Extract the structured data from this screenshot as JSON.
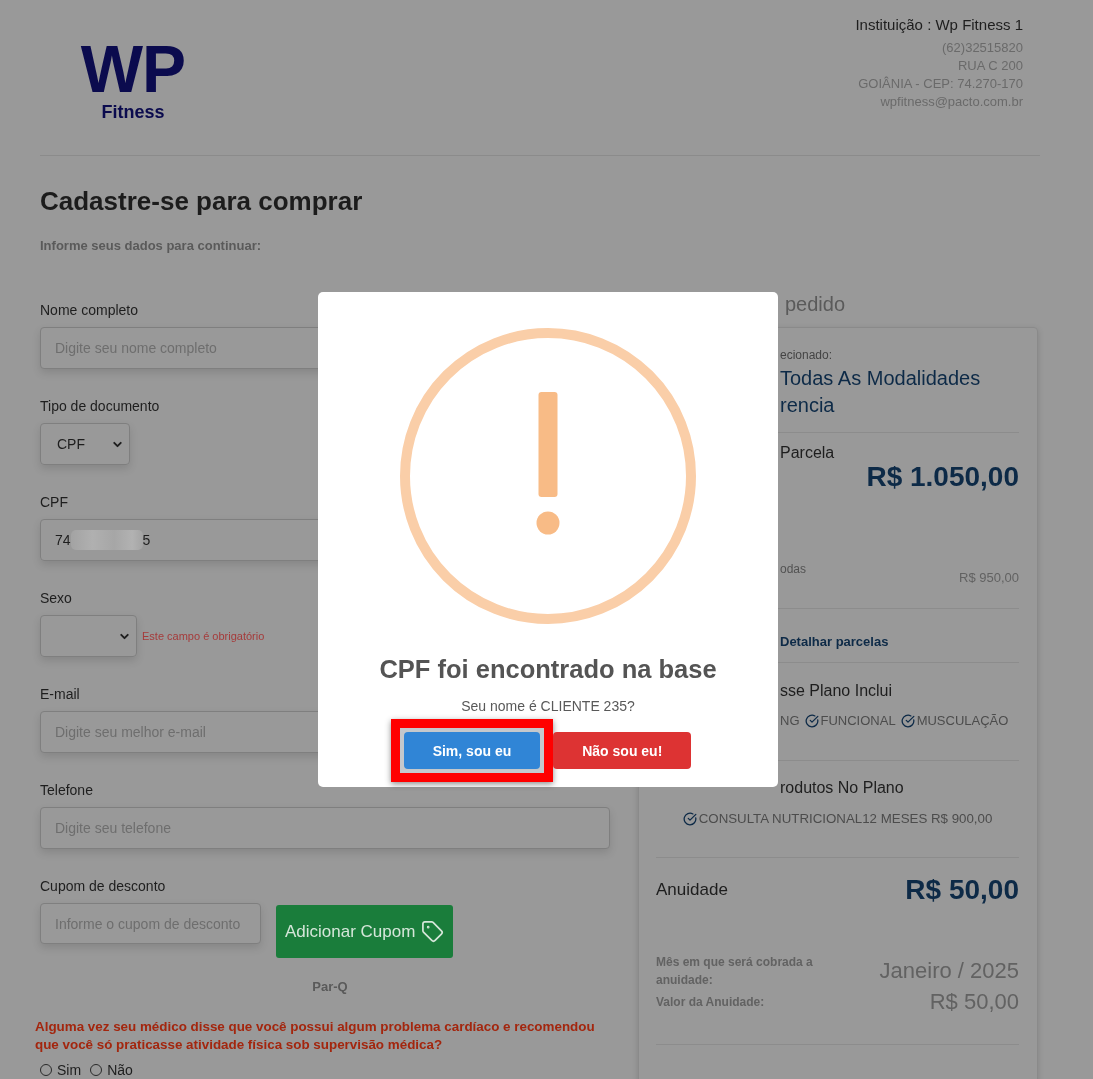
{
  "header": {
    "logo": {
      "mark": "WP",
      "subtitle": "Fitness"
    },
    "institution": "Instituição : Wp Fitness 1",
    "contact_lines": [
      "(62)32515820",
      "RUA C 200",
      "GOIÂNIA - CEP: 74.270-170",
      "wpfitness@pacto.com.br"
    ]
  },
  "form": {
    "title": "Cadastre-se para comprar",
    "subtitle": "Informe seus dados para continuar:",
    "fields": [
      {
        "kind": "input",
        "label": "Nome completo",
        "placeholder": "Digite seu nome completo"
      },
      {
        "kind": "select",
        "label": "Tipo de documento",
        "value": "CPF"
      },
      {
        "kind": "redacted_input",
        "label": "CPF",
        "value_start": "74",
        "value_end": "5"
      },
      {
        "kind": "select",
        "label": "Sexo",
        "error": "Este campo é obrigatório"
      },
      {
        "kind": "input",
        "label": "E-mail",
        "placeholder": "Digite seu melhor e-mail"
      },
      {
        "kind": "input",
        "label": "Telefone",
        "placeholder": "Digite seu telefone"
      },
      {
        "kind": "coupon",
        "label": "Cupom de desconto",
        "placeholder": "Informe o cupom de desconto",
        "button": "Adicionar Cupom"
      }
    ],
    "parq": {
      "title": "Par-Q",
      "question": "Alguma vez seu médico disse que você possui algum problema cardíaco e recomendou que você só praticasse atividade física sob supervisão médica?",
      "options": [
        {
          "label": "Sim",
          "selected": false
        },
        {
          "label": "Não",
          "selected": false
        }
      ]
    }
  },
  "order_summary": {
    "heading": "pedido",
    "plan_label": "ecionado:",
    "plan_name": [
      "Todas As Modalidades",
      "rencia"
    ],
    "installment": {
      "label": "Parcela",
      "price": "R$ 1.050,00"
    },
    "discount": {
      "label": "odas",
      "value": "R$ 950,00"
    },
    "details_link": "Detalhar parcelas",
    "includes": {
      "title": "sse Plano Inclui",
      "items": [
        {
          "label": "NG",
          "check_icon": false
        },
        {
          "label": "FUNCIONAL",
          "check_icon": true
        },
        {
          "label": "MUSCULAÇÃO",
          "check_icon": true
        }
      ]
    },
    "products": {
      "title": "rodutos No Plano",
      "items": [
        "CONSULTA NUTRICIONAL12 MESES R$ 900,00"
      ]
    },
    "annuity": {
      "label": "Anuidade",
      "price": "R$ 50,00",
      "month_label": "Mês em que será cobrada a anuidade:",
      "month_value": "Janeiro / 2025",
      "value_label": "Valor da Anuidade:",
      "value": "R$ 50,00"
    }
  },
  "dialog": {
    "title": "CPF foi encontrado na base",
    "message": "Seu nome é CLIENTE 235?",
    "buttons": [
      {
        "label": "Sim, sou eu",
        "kind": "confirm",
        "highlighted": true
      },
      {
        "label": "Não sou eu!",
        "kind": "cancel",
        "highlighted": false
      }
    ]
  }
}
